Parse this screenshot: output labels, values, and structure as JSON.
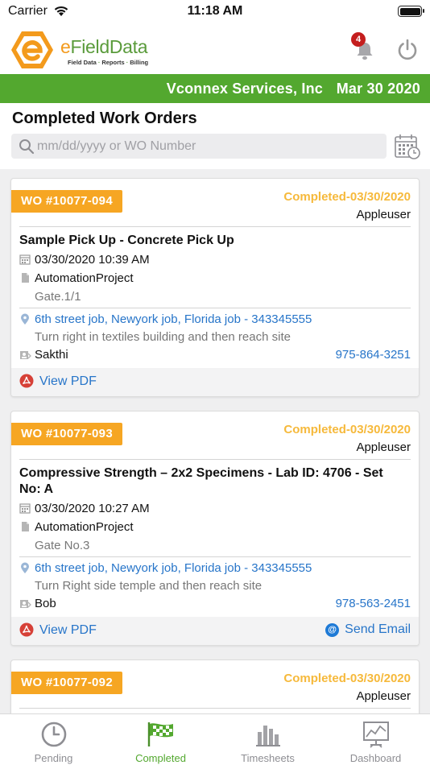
{
  "status_bar": {
    "carrier": "Carrier",
    "time": "11:18 AM"
  },
  "header": {
    "logo": {
      "e": "e",
      "field_data": "FieldData",
      "tagline": [
        "Field Data",
        "Reports",
        "Billing"
      ]
    },
    "notification_count": "4"
  },
  "banner": {
    "company": "Vconnex Services, Inc",
    "date": "Mar 30 2020"
  },
  "page_title": "Completed Work Orders",
  "search": {
    "placeholder": "mm/dd/yyyy or WO Number",
    "value": ""
  },
  "work_orders": [
    {
      "wo_number": "WO #10077-094",
      "status": "Completed-03/30/2020",
      "user": "Appleuser",
      "title": "Sample Pick Up - Concrete Pick Up",
      "datetime": "03/30/2020 10:39 AM",
      "project": "AutomationProject",
      "gate": "Gate.1/1",
      "location": "6th street job, Newyork job, Florida job - 343345555",
      "directions": "Turn right in textiles building and then reach site",
      "contact": "Sakthi",
      "phone": "975-864-3251",
      "view_pdf": "View PDF"
    },
    {
      "wo_number": "WO #10077-093",
      "status": "Completed-03/30/2020",
      "user": "Appleuser",
      "title": "Compressive Strength – 2x2 Specimens - Lab ID: 4706  - Set No: A",
      "datetime": "03/30/2020 10:27 AM",
      "project": "AutomationProject",
      "gate": "Gate No.3",
      "location": "6th street job, Newyork job, Florida job - 343345555",
      "directions": "Turn Right side temple and then reach site",
      "contact": "Bob",
      "phone": "978-563-2451",
      "view_pdf": "View PDF",
      "send_email": "Send Email"
    },
    {
      "wo_number": "WO #10077-092",
      "status": "Completed-03/30/2020",
      "user": "Appleuser"
    }
  ],
  "tabs": [
    {
      "label": "Pending",
      "icon": "clock-icon"
    },
    {
      "label": "Completed",
      "icon": "flag-icon"
    },
    {
      "label": "Timesheets",
      "icon": "bar-chart-icon"
    },
    {
      "label": "Dashboard",
      "icon": "dashboard-icon"
    }
  ],
  "colors": {
    "green": "#53a82f",
    "orange": "#f6a623",
    "link": "#2775c9"
  }
}
